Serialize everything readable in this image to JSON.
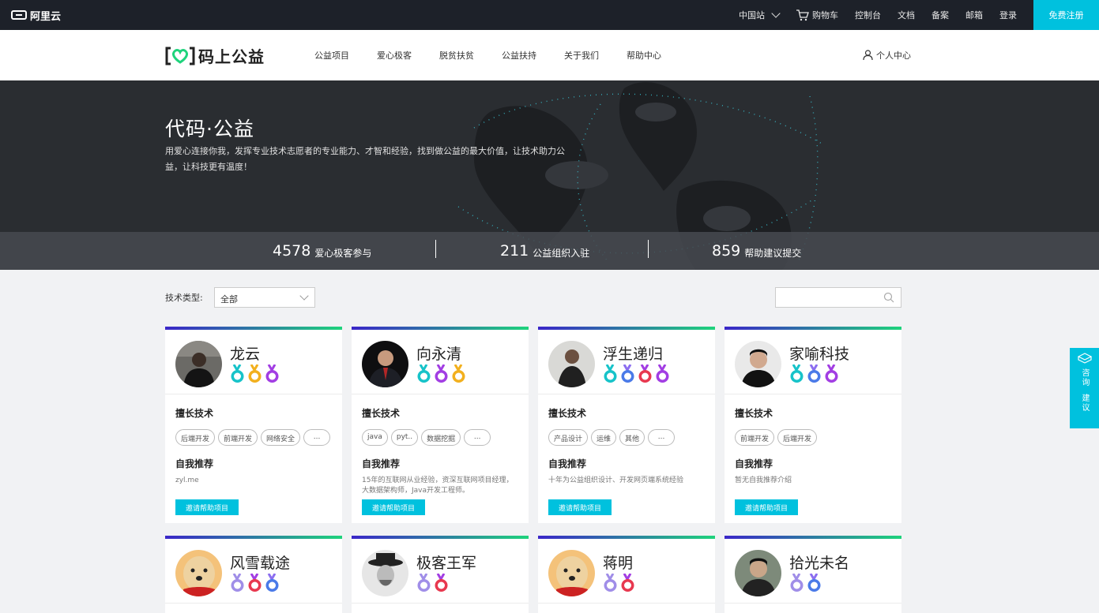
{
  "topbar": {
    "logo_text": "阿里云",
    "region": "中国站",
    "cart": "购物车",
    "console": "控制台",
    "docs": "文档",
    "beian": "备案",
    "mail": "邮箱",
    "login": "登录",
    "signup": "免费注册"
  },
  "header": {
    "brand": "码上公益",
    "nav": [
      "公益项目",
      "爱心极客",
      "脱贫扶贫",
      "公益扶持",
      "关于我们",
      "帮助中心"
    ],
    "personal": "个人中心"
  },
  "hero": {
    "title": "代码·公益",
    "desc": "用爱心连接你我，发挥专业技术志愿者的专业能力、才智和经验，找到做公益的最大价值，让技术助力公益，让科技更有温度！"
  },
  "stats": [
    {
      "num": "4578",
      "label": "爱心极客参与"
    },
    {
      "num": "211",
      "label": "公益组织入驻"
    },
    {
      "num": "859",
      "label": "帮助建议提交"
    }
  ],
  "filter": {
    "label": "技术类型:",
    "selected": "全部",
    "search_placeholder": ""
  },
  "labels": {
    "skills": "擅长技术",
    "recommend": "自我推荐",
    "invite": "邀请帮助项目"
  },
  "cards_row1": [
    {
      "name": "龙云",
      "tags": [
        "后端开发",
        "前端开发",
        "网络安全",
        "..."
      ],
      "rec": "zyl.me"
    },
    {
      "name": "向永清",
      "tags": [
        "java",
        "pyt..",
        "数据挖掘",
        "..."
      ],
      "rec": "15年的互联网从业经验，资深互联网项目经理，大数据架构师，Java开发工程师。"
    },
    {
      "name": "浮生递归",
      "tags": [
        "产品设计",
        "运维",
        "其他",
        "..."
      ],
      "rec": "十年为公益组织设计、开发网页端系统经验"
    },
    {
      "name": "家喻科技",
      "tags": [
        "前端开发",
        "后端开发"
      ],
      "rec": "暂无自我推荐介绍"
    }
  ],
  "cards_row2": [
    {
      "name": "风雪载途"
    },
    {
      "name": "极客王军"
    },
    {
      "name": "蒋明"
    },
    {
      "name": "拾光未名"
    }
  ],
  "side_float": {
    "text1": "咨询",
    "text2": "建议"
  },
  "colors": {
    "accent": "#00c1de",
    "topbar": "#1d2129",
    "hero": "#2a2d31"
  }
}
